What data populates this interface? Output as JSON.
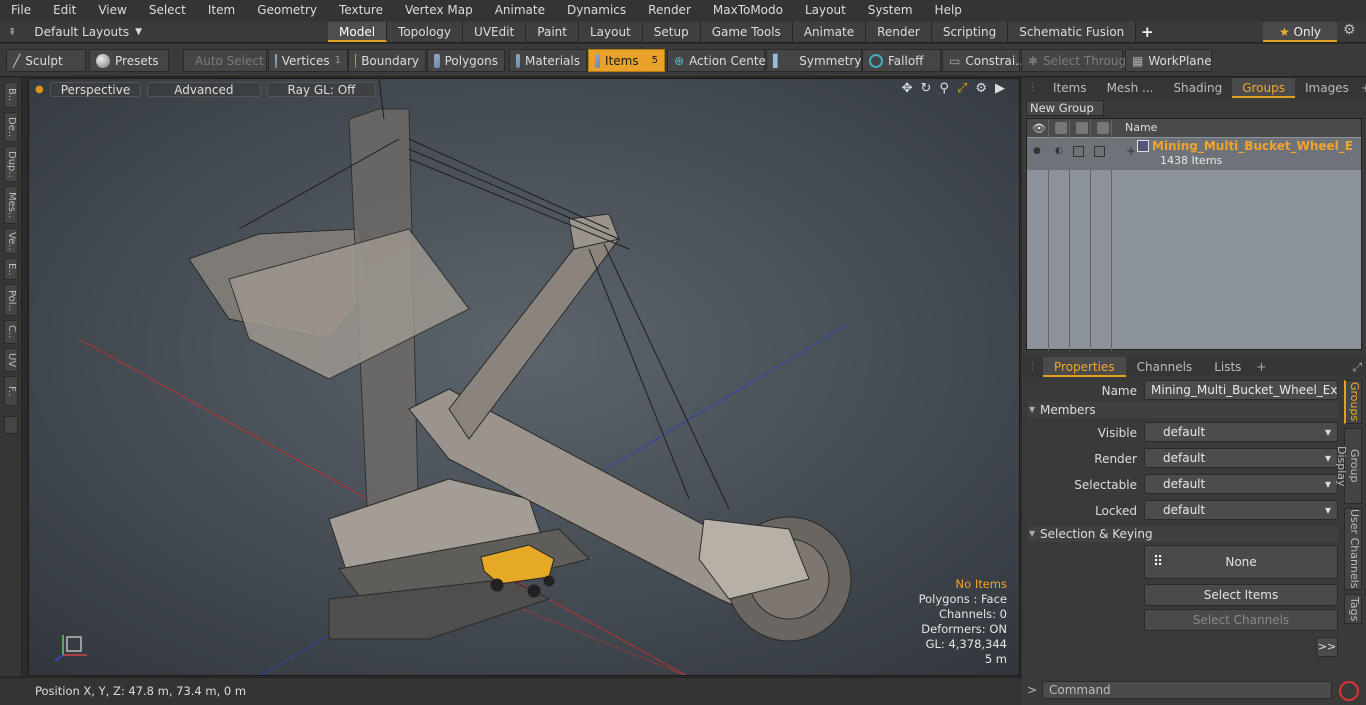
{
  "menu": [
    "File",
    "Edit",
    "View",
    "Select",
    "Item",
    "Geometry",
    "Texture",
    "Vertex Map",
    "Animate",
    "Dynamics",
    "Render",
    "MaxToModo",
    "Layout",
    "System",
    "Help"
  ],
  "layouts": {
    "label": "Default Layouts"
  },
  "tabs": [
    "Model",
    "Topology",
    "UVEdit",
    "Paint",
    "Layout",
    "Setup",
    "Game Tools",
    "Animate",
    "Render",
    "Scripting",
    "Schematic Fusion"
  ],
  "only": "Only",
  "toolbar": {
    "sculpt": "Sculpt",
    "presets": "Presets",
    "auto_select": "Auto Select",
    "vertices": "Vertices",
    "vertices_count": "1",
    "boundary": "Boundary",
    "polygons": "Polygons",
    "materials": "Materials",
    "items": "Items",
    "items_count": "5",
    "action_center": "Action Center",
    "symmetry": "Symmetry",
    "falloff": "Falloff",
    "constraints": "Constrai...",
    "select_through": "Select Through",
    "workplane": "WorkPlane"
  },
  "left_tabs": [
    "B..",
    "De..",
    "Dup..",
    "Mes..",
    "Ve..",
    "E..",
    "Pol..",
    "C..",
    "UV",
    "F.."
  ],
  "viewport": {
    "perspective": "Perspective",
    "advanced": "Advanced",
    "raygl": "Ray GL: Off",
    "stats": {
      "items": "No Items",
      "polygons": "Polygons : Face",
      "channels": "Channels: 0",
      "deformers": "Deformers: ON",
      "gl": "GL: 4,378,344",
      "scale": "5 m"
    }
  },
  "status": {
    "position": "Position X, Y, Z:  47.8 m, 73.4 m, 0 m"
  },
  "right_tabs": [
    "Items",
    "Mesh ...",
    "Shading",
    "Groups",
    "Images"
  ],
  "groups": {
    "new_group": "New Group",
    "name_header": "Name",
    "item_name": "Mining_Multi_Bucket_Wheel_Ex ...",
    "item_count": "1438 Items"
  },
  "prop_tabs": [
    "Properties",
    "Channels",
    "Lists"
  ],
  "properties": {
    "name_label": "Name",
    "name_value": "Mining_Multi_Bucket_Wheel_Excavatc",
    "members": "Members",
    "visible_label": "Visible",
    "visible_value": "default",
    "render_label": "Render",
    "render_value": "default",
    "selectable_label": "Selectable",
    "selectable_value": "default",
    "locked_label": "Locked",
    "locked_value": "default",
    "sel_keying": "Selection & Keying",
    "none": "None",
    "select_items": "Select Items",
    "select_channels": "Select Channels",
    "more": ">>"
  },
  "side_tabs": [
    "Groups",
    "Group Display",
    "User Channels",
    "Tags"
  ],
  "command": {
    "placeholder": "Command"
  }
}
